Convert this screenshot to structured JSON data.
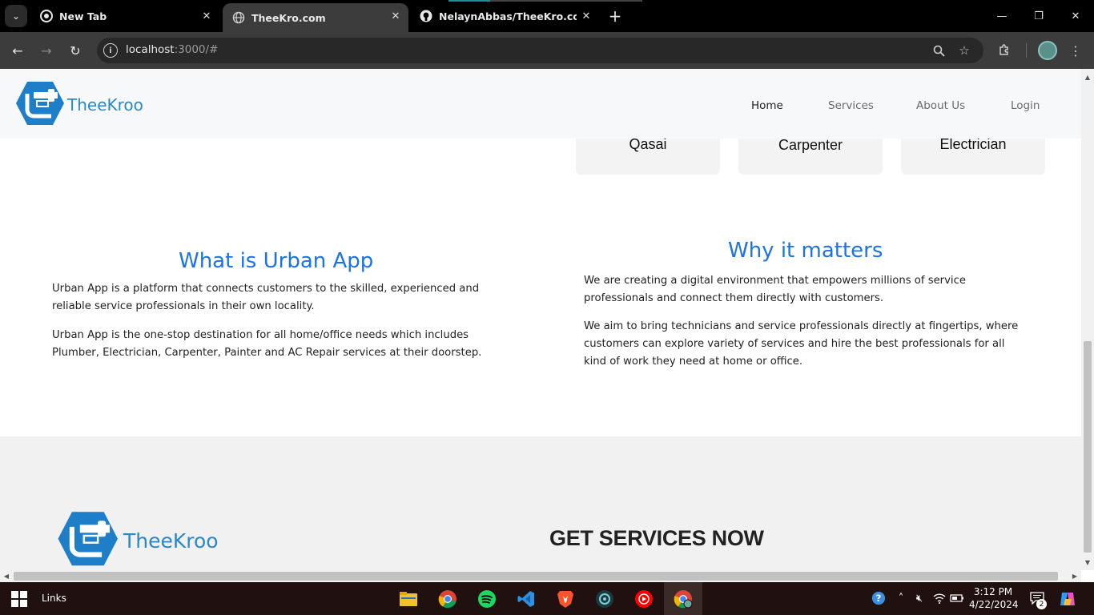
{
  "browser": {
    "tabs": [
      {
        "title": "New Tab",
        "icon": "chrome-icon"
      },
      {
        "title": "TheeKro.com",
        "icon": "globe-icon",
        "active": true
      },
      {
        "title": "NelaynAbbas/TheeKro.com: Th",
        "icon": "github-icon"
      }
    ],
    "close_glyph": "✕",
    "new_tab_glyph": "+",
    "url_host": "localhost",
    "url_rest": ":3000/#",
    "window_controls": {
      "minimize": "—",
      "restore": "❐",
      "close": "✕"
    }
  },
  "site": {
    "brand": "TheeKroo",
    "brand_color": "#2a88c9",
    "accent_color": "#1a73e8",
    "nav": [
      {
        "label": "Home",
        "active": true
      },
      {
        "label": "Services"
      },
      {
        "label": "About Us"
      },
      {
        "label": "Login"
      }
    ],
    "service_cards": [
      {
        "label": "Qasai"
      },
      {
        "label": "Carpenter"
      },
      {
        "label": "Electrician"
      }
    ],
    "what_is": {
      "title": "What is Urban App",
      "paragraphs": [
        "Urban App is a platform that connects customers to the skilled, experienced and reliable service professionals in their own locality.",
        "Urban App is the one-stop destination for all home/office needs which includes Plumber, Electrician, Carpenter, Painter and AC Repair services at their doorstep."
      ]
    },
    "why_matters": {
      "title": "Why it matters",
      "paragraphs": [
        "We are creating a digital environment that empowers millions of service professionals and connect them directly with customers.",
        "We aim to bring technicians and service professionals directly at fingertips, where customers can explore variety of services and hire the best professionals for all kind of work they need at home or office."
      ]
    },
    "footer": {
      "brand": "TheeKroo",
      "heading": "GET SERVICES NOW"
    }
  },
  "taskbar": {
    "links_label": "Links",
    "time": "3:12 PM",
    "date": "4/22/2024",
    "notification_count": "2"
  }
}
